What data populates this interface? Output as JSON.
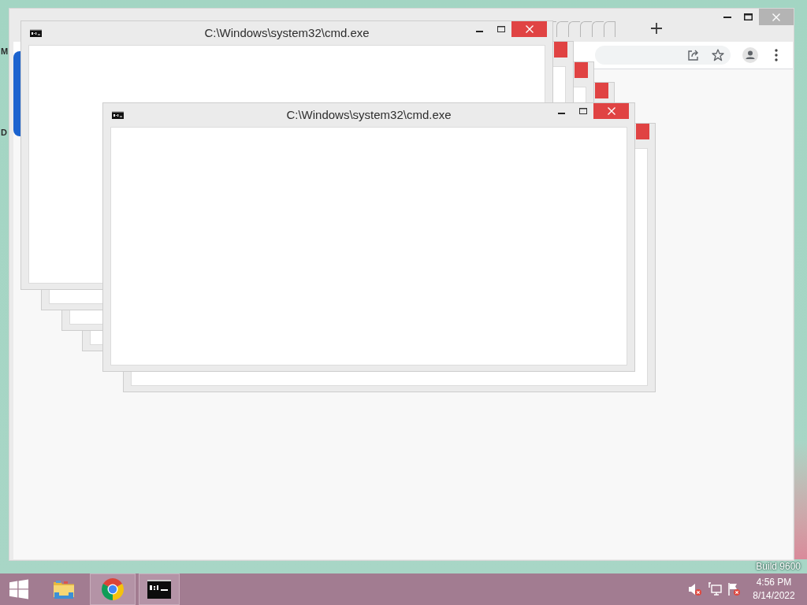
{
  "desktop": {
    "icon_labels": [
      "M",
      "D"
    ],
    "watermark": "Build 9600"
  },
  "windows": [
    {
      "kind": "window",
      "title": "C:\\Windows\\system32\\cmd.exe"
    },
    {
      "kind": "trail"
    },
    {
      "kind": "trail"
    },
    {
      "kind": "trail"
    },
    {
      "kind": "window",
      "title": "C:\\Windows\\system32\\cmd.exe"
    },
    {
      "kind": "trail"
    }
  ],
  "taskbar": {
    "apps": [
      {
        "kind": "explorer",
        "running": false
      },
      {
        "kind": "chrome",
        "running": true
      },
      {
        "kind": "cmd",
        "running": true
      }
    ],
    "tray": {
      "volume": {
        "muted": true
      },
      "action_center": {
        "alert": true
      },
      "clock": {
        "time": "4:56 PM",
        "date": "8/14/2022"
      }
    }
  }
}
